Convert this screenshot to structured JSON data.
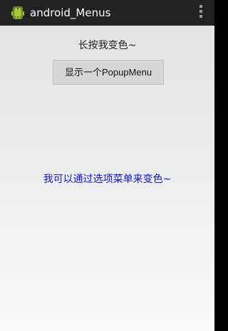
{
  "action_bar": {
    "title": "android_Menus",
    "app_icon": "android-robot-icon",
    "overflow_icon": "overflow-menu-icon"
  },
  "main": {
    "longpress_text": "长按我变色~",
    "popup_button_label": "显示一个PopupMenu",
    "option_text": "我可以通过选项菜单来变色~"
  },
  "colors": {
    "action_bar_bg": "#222222",
    "option_text": "#1010d8",
    "button_bg": "#d6d6d6"
  }
}
